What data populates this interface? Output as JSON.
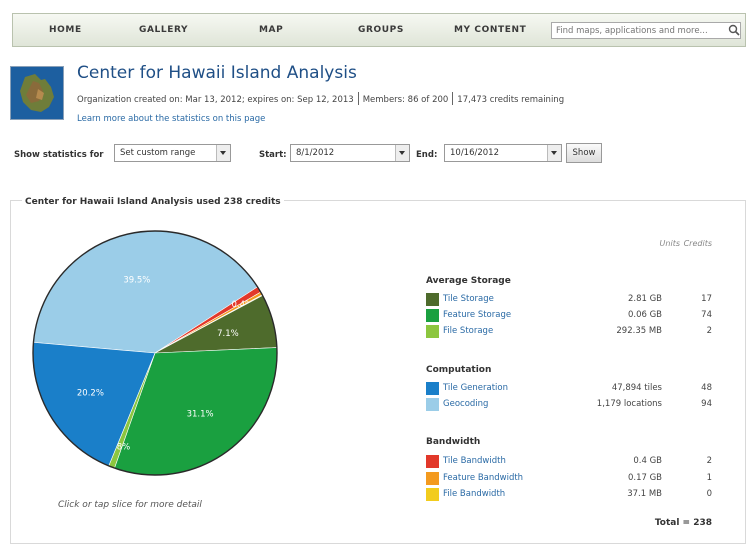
{
  "nav": {
    "items": [
      "HOME",
      "GALLERY",
      "MAP",
      "GROUPS",
      "MY CONTENT"
    ],
    "search_placeholder": "Find maps, applications and more..."
  },
  "org": {
    "title": "Center for Hawaii Island Analysis",
    "created": "Organization created on: Mar 13, 2012; expires on: Sep 12, 2013",
    "members": "Members: 86 of 200",
    "credits": "17,473 credits remaining",
    "learn_link": "Learn more about the statistics on this page"
  },
  "filters": {
    "show_label": "Show statistics for",
    "range_value": "Set custom range",
    "start_label": "Start:",
    "start_value": "8/1/2012",
    "end_label": "End:",
    "end_value": "10/16/2012",
    "show_button": "Show"
  },
  "panel": {
    "title": "Center for Hawaii Island Analysis used 238 credits",
    "caption": "Click or tap slice for more detail",
    "col_units": "Units",
    "col_credits": "Credits",
    "total": "Total = 238"
  },
  "groups": [
    {
      "name": "Average Storage",
      "items": [
        {
          "label": "Tile Storage",
          "units": "2.81 GB",
          "credits": "17",
          "color": "#4e6b2c"
        },
        {
          "label": "Feature Storage",
          "units": "0.06 GB",
          "credits": "74",
          "color": "#1aa040"
        },
        {
          "label": "File Storage",
          "units": "292.35 MB",
          "credits": "2",
          "color": "#8cc63f"
        }
      ]
    },
    {
      "name": "Computation",
      "items": [
        {
          "label": "Tile Generation",
          "units": "47,894 tiles",
          "credits": "48",
          "color": "#1a7fc9"
        },
        {
          "label": "Geocoding",
          "units": "1,179 locations",
          "credits": "94",
          "color": "#9bcde8"
        }
      ]
    },
    {
      "name": "Bandwidth",
      "items": [
        {
          "label": "Tile Bandwidth",
          "units": "0.4 GB",
          "credits": "2",
          "color": "#e2382a"
        },
        {
          "label": "Feature Bandwidth",
          "units": "0.17 GB",
          "credits": "1",
          "color": "#f39a1f"
        },
        {
          "label": "File Bandwidth",
          "units": "37.1 MB",
          "credits": "0",
          "color": "#f2cc1d"
        }
      ]
    }
  ],
  "chart_data": {
    "type": "pie",
    "slices": [
      {
        "name": "Geocoding",
        "value": 39.5,
        "label": "39.5%",
        "color": "#9bcde8"
      },
      {
        "name": "Tile Bandwidth",
        "value": 0.8,
        "label": "",
        "color": "#e2382a"
      },
      {
        "name": "Feature Bandwidth",
        "value": 0.4,
        "label": "0.4%",
        "color": "#f39a1f"
      },
      {
        "name": "File Bandwidth",
        "value": 0.1,
        "label": "",
        "color": "#f2cc1d"
      },
      {
        "name": "Tile Storage",
        "value": 7.1,
        "label": "7.1%",
        "color": "#4e6b2c"
      },
      {
        "name": "Feature Storage",
        "value": 31.1,
        "label": "31.1%",
        "color": "#1aa040"
      },
      {
        "name": "File Storage",
        "value": 0.8,
        "label": "0.8%",
        "color": "#8cc63f"
      },
      {
        "name": "Tile Generation",
        "value": 20.2,
        "label": "20.2%",
        "color": "#1a7fc9"
      }
    ]
  }
}
